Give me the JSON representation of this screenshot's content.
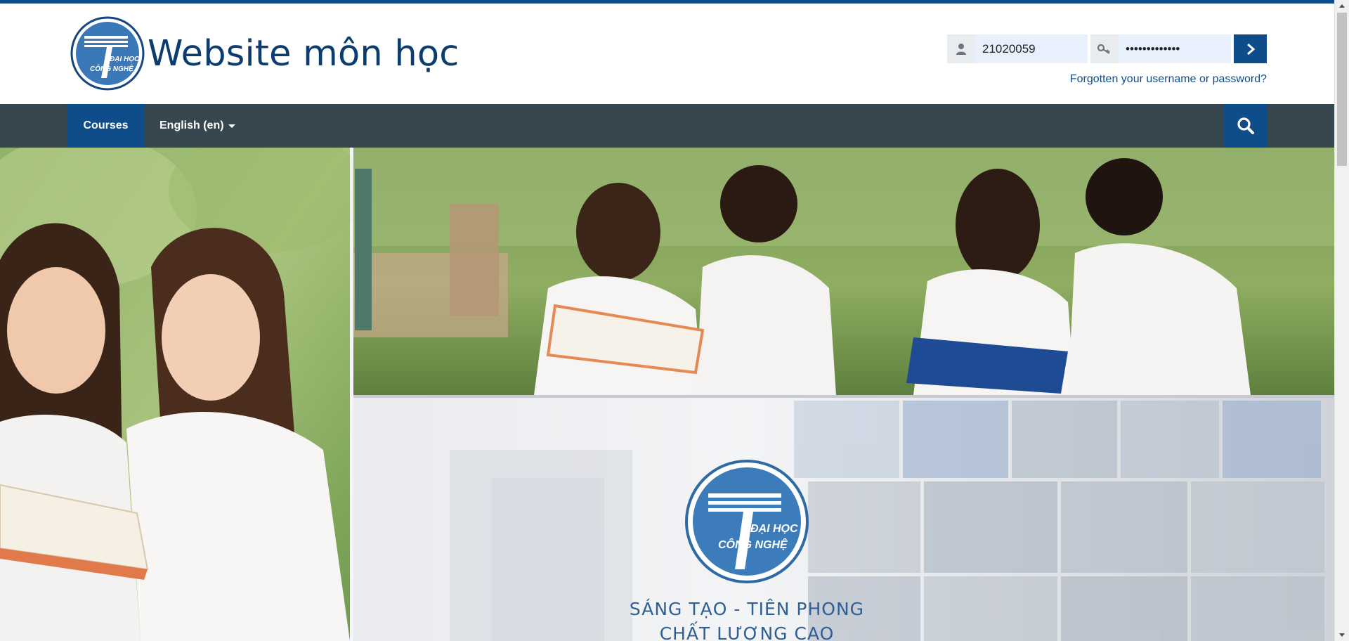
{
  "site": {
    "title": "Website môn học",
    "logo_line1": "ĐẠI HỌC",
    "logo_line2": "CÔNG NGHỆ"
  },
  "login": {
    "username_value": "21020059",
    "password_value": "•••••••••••••",
    "forgot_label": "Forgotten your username or password?",
    "user_icon": "user-icon",
    "key_icon": "key-icon",
    "submit_icon": "chevron-right-icon"
  },
  "nav": {
    "courses_label": "Courses",
    "language_label": "English ‎(en)‎",
    "search_icon": "search-icon"
  },
  "hero": {
    "slogan_line1": "SÁNG TẠO - TIÊN PHONG",
    "slogan_line2": "CHẤT LƯỢNG CAO",
    "emblem_line1": "ĐẠI HỌC",
    "emblem_line2": "CÔNG NGHỆ"
  },
  "colors": {
    "brand": "#0f4c8a",
    "navbar": "#37474f",
    "input_bg": "#e8f0fe"
  }
}
